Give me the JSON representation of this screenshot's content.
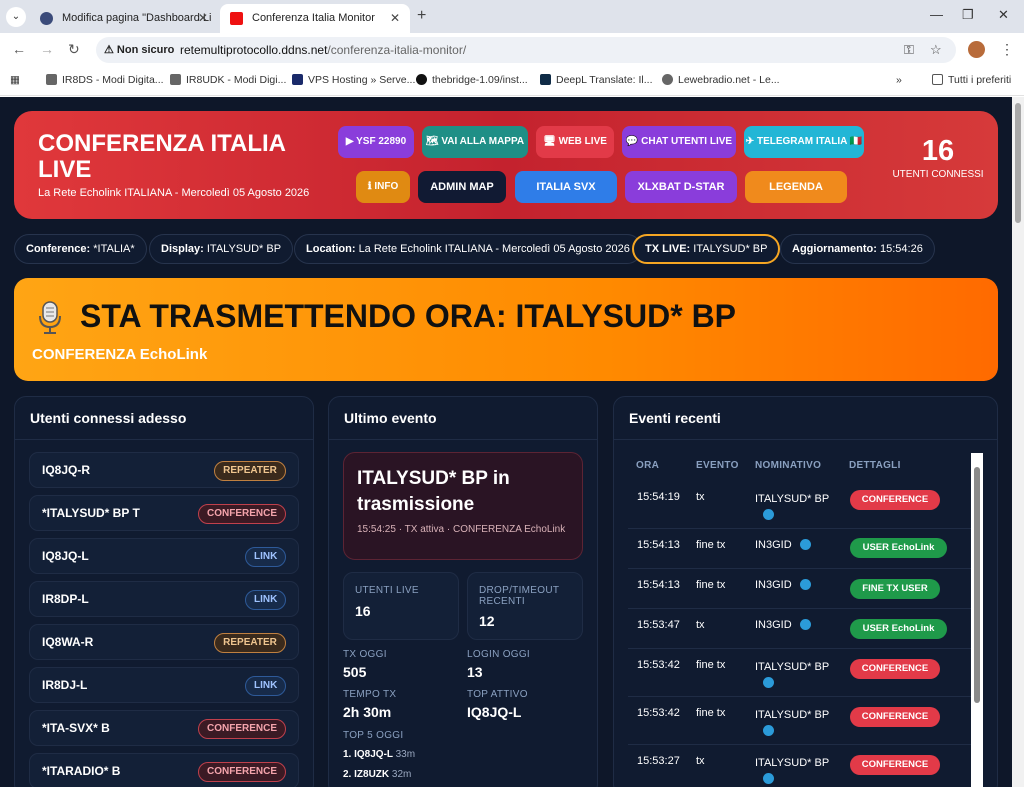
{
  "browser": {
    "tabs": [
      {
        "title": "Modifica pagina \"Dashboard Li",
        "fav_color": "#3b4b7a"
      },
      {
        "title": "Conferenza Italia Monitor",
        "fav_color": "#e11"
      }
    ],
    "secure_label": "Non sicuro",
    "url_host": "retemultiprotocollo.ddns.net",
    "url_path": "/conferenza-italia-monitor/",
    "bookmarks": [
      "IR8DS - Modi Digita...",
      "IR8UDK - Modi Digi...",
      "VPS Hosting » Serve...",
      "thebridge-1.09/inst...",
      "DeepL Translate: Il...",
      "Lewebradio.net - Le..."
    ],
    "bookmarks_more": "»",
    "bookmarks_folder": "Tutti i preferiti"
  },
  "hero": {
    "title": "CONFERENZA ITALIA LIVE",
    "subtitle": "La Rete Echolink ITALIANA - Mercoledì 05 Agosto 2026",
    "buttons": [
      {
        "label": "▶ YSF 22890"
      },
      {
        "label": "🗺 VAI ALLA MAPPA"
      },
      {
        "label": "🖥 WEB LIVE"
      },
      {
        "label": "💬 CHAT UTENTI LIVE"
      },
      {
        "label": "✈ TELEGRAM ITALIA 🇮🇹"
      },
      {
        "label": "ℹ INFO"
      },
      {
        "label": "ADMIN MAP"
      },
      {
        "label": "ITALIA SVX"
      },
      {
        "label": "XLXBAT D-STAR"
      },
      {
        "label": "LEGENDA"
      }
    ],
    "count": "16",
    "count_label": "UTENTI CONNESSI"
  },
  "pills": [
    {
      "label": "Conference:",
      "value": "*ITALIA*"
    },
    {
      "label": "Display:",
      "value": "ITALYSUD* BP"
    },
    {
      "label": "Location:",
      "value": "La Rete Echolink ITALIANA - Mercoledì 05 Agosto 2026"
    },
    {
      "label": "TX LIVE:",
      "value": "ITALYSUD* BP"
    },
    {
      "label": "Aggiornamento:",
      "value": "15:54:26"
    }
  ],
  "tx_banner": {
    "title": "STA TRASMETTENDO ORA: ITALYSUD* BP",
    "subtitle": "CONFERENZA EchoLink"
  },
  "users_card": {
    "title": "Utenti connessi adesso",
    "users": [
      {
        "name": "IQ8JQ-R",
        "type": "REPEATER"
      },
      {
        "name": "*ITALYSUD* BP T",
        "type": "CONFERENCE"
      },
      {
        "name": "IQ8JQ-L",
        "type": "LINK"
      },
      {
        "name": "IR8DP-L",
        "type": "LINK"
      },
      {
        "name": "IQ8WA-R",
        "type": "REPEATER"
      },
      {
        "name": "IR8DJ-L",
        "type": "LINK"
      },
      {
        "name": "*ITA-SVX* B",
        "type": "CONFERENCE"
      },
      {
        "name": "*ITARADIO* B",
        "type": "CONFERENCE"
      }
    ]
  },
  "last_event": {
    "title": "Ultimo evento",
    "event_title": "ITALYSUD* BP in trasmissione",
    "event_meta": "15:54:25 · TX attiva · CONFERENZA EchoLink",
    "stats": {
      "utenti_live_label": "UTENTI LIVE",
      "utenti_live": "16",
      "drop_label": "DROP/TIMEOUT RECENTI",
      "drop": "12",
      "tx_oggi_label": "TX OGGI",
      "tx_oggi": "505",
      "login_oggi_label": "LOGIN OGGI",
      "login_oggi": "13",
      "tempo_tx_label": "TEMPO TX",
      "tempo_tx": "2h 30m",
      "top_attivo_label": "TOP ATTIVO",
      "top_attivo": "IQ8JQ-L",
      "top5_label": "TOP 5 OGGI"
    },
    "top5": [
      {
        "rank": "1.",
        "call": "IQ8JQ-L",
        "time": "33m"
      },
      {
        "rank": "2.",
        "call": "IZ8UZK",
        "time": "32m"
      }
    ]
  },
  "recent_events": {
    "title": "Eventi recenti",
    "headers": [
      "ORA",
      "EVENTO",
      "NOMINATIVO",
      "DETTAGLI"
    ],
    "rows": [
      {
        "time": "15:54:19",
        "event": "tx",
        "call": "ITALYSUD* BP",
        "detail": "CONFERENCE",
        "kind": "conf"
      },
      {
        "time": "15:54:13",
        "event": "fine tx",
        "call": "IN3GID",
        "detail": "USER EchoLink",
        "kind": "user"
      },
      {
        "time": "15:54:13",
        "event": "fine tx",
        "call": "IN3GID",
        "detail": "FINE TX USER",
        "kind": "user"
      },
      {
        "time": "15:53:47",
        "event": "tx",
        "call": "IN3GID",
        "detail": "USER EchoLink",
        "kind": "user"
      },
      {
        "time": "15:53:42",
        "event": "fine tx",
        "call": "ITALYSUD* BP",
        "detail": "CONFERENCE",
        "kind": "conf"
      },
      {
        "time": "15:53:42",
        "event": "fine tx",
        "call": "ITALYSUD* BP",
        "detail": "CONFERENCE",
        "kind": "conf"
      },
      {
        "time": "15:53:27",
        "event": "tx",
        "call": "ITALYSUD* BP",
        "detail": "CONFERENCE",
        "kind": "conf"
      }
    ]
  }
}
